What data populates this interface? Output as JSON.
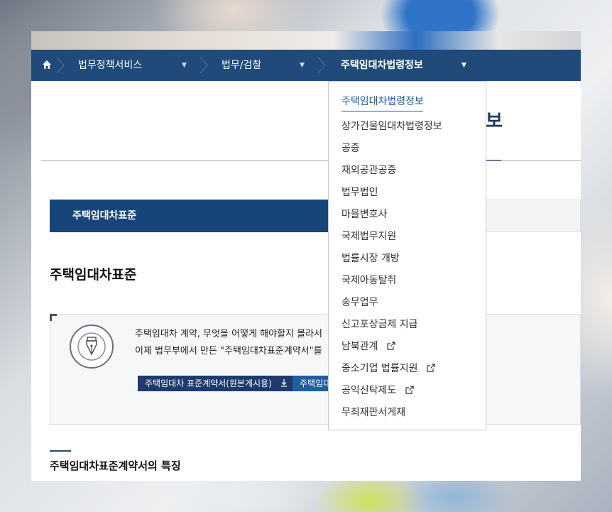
{
  "nav": {
    "breadcrumbs": [
      {
        "label": "법무정책서비스"
      },
      {
        "label": "법무/검찰"
      },
      {
        "label": "주택임대차법령정보"
      }
    ]
  },
  "page": {
    "title_partial": "보",
    "tab_active": "주택임대차표준",
    "section_heading": "주택임대차표준",
    "info_line1": "주택임대차 계약, 무엇을 어떻게 해야할지 몰라서",
    "info_line2": "이제 법무부에서 만든 \"주택임대차표준계약서\"를",
    "download_button": "주택임대차 표준계약서(원본게시용)",
    "download_button2": "주택임대",
    "features_heading": "주택임대차표준계약서의 특징"
  },
  "dropdown": {
    "items": [
      {
        "label": "주택임대차법령정보",
        "selected": true,
        "external": false
      },
      {
        "label": "상가건물임대차법령정보",
        "selected": false,
        "external": false
      },
      {
        "label": "공증",
        "selected": false,
        "external": false
      },
      {
        "label": "재외공관공증",
        "selected": false,
        "external": false
      },
      {
        "label": "법무법인",
        "selected": false,
        "external": false
      },
      {
        "label": "마을변호사",
        "selected": false,
        "external": false
      },
      {
        "label": "국제법무지원",
        "selected": false,
        "external": false
      },
      {
        "label": "법률시장 개방",
        "selected": false,
        "external": false
      },
      {
        "label": "국제아동탈취",
        "selected": false,
        "external": false
      },
      {
        "label": "송무업무",
        "selected": false,
        "external": false
      },
      {
        "label": "신고포상금제 지급",
        "selected": false,
        "external": false
      },
      {
        "label": "남북관계",
        "selected": false,
        "external": true
      },
      {
        "label": "중소기업 법률지원",
        "selected": false,
        "external": true
      },
      {
        "label": "공익신탁제도",
        "selected": false,
        "external": true
      },
      {
        "label": "무죄재판서게재",
        "selected": false,
        "external": false
      }
    ]
  },
  "colors": {
    "nav_bg": "#1f4a7a",
    "tab_active_bg": "#17457a",
    "selected_text": "#1f5ca6",
    "button_dark": "#1f3a6e"
  }
}
